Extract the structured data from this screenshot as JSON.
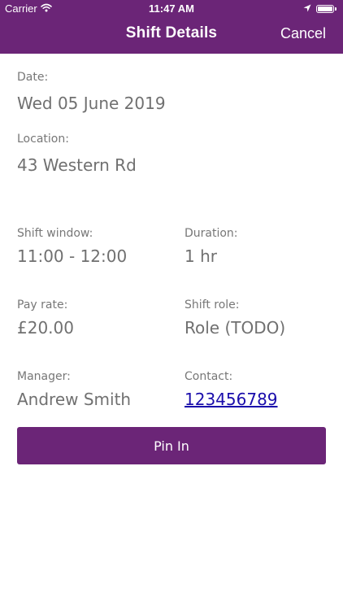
{
  "status_bar": {
    "carrier": "Carrier",
    "time": "11:47 AM",
    "battery_level": 1.0,
    "icons": [
      "wifi-icon",
      "location-arrow-icon",
      "battery-icon"
    ]
  },
  "nav": {
    "title": "Shift Details",
    "cancel_label": "Cancel"
  },
  "details": {
    "date": {
      "label": "Date:",
      "value": "Wed 05 June 2019"
    },
    "location": {
      "label": "Location:",
      "value": "43 Western Rd"
    },
    "shift_window": {
      "label": "Shift window:",
      "value": "11:00 - 12:00"
    },
    "duration": {
      "label": "Duration:",
      "value": "1 hr"
    },
    "pay_rate": {
      "label": "Pay rate:",
      "value": "£20.00"
    },
    "shift_role": {
      "label": "Shift role:",
      "value": "Role (TODO)"
    },
    "manager": {
      "label": "Manager:",
      "value": "Andrew Smith"
    },
    "contact": {
      "label": "Contact:",
      "value": "123456789"
    }
  },
  "actions": {
    "pin_in_label": "Pin In"
  },
  "colors": {
    "brand": "#6b2577",
    "link": "#1a0dab",
    "label": "#777777",
    "value": "#707070"
  }
}
